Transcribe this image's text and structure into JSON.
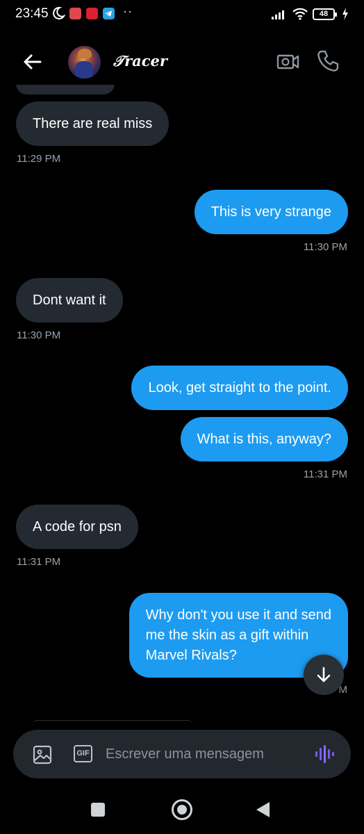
{
  "status_bar": {
    "time": "23:45",
    "battery": "48",
    "icons": [
      "moon-icon",
      "app-notification-icon",
      "app-notification-icon",
      "telegram-icon",
      "more-dots-icon",
      "signal-icon",
      "wifi-icon",
      "battery-icon",
      "charging-icon"
    ]
  },
  "header": {
    "contact_name": "𝒯racer",
    "back_icon": "arrow-left-icon",
    "video_icon": "video-camera-icon",
    "call_icon": "phone-icon"
  },
  "messages": [
    {
      "dir": "in",
      "text": "There are real miss",
      "time": "11:29 PM"
    },
    {
      "dir": "out",
      "text": "This is very strange",
      "time": "11:30 PM"
    },
    {
      "dir": "in",
      "text": "Dont want it",
      "time": "11:30 PM"
    },
    {
      "dir": "out",
      "text": "Look, get straight to the point.",
      "time": ""
    },
    {
      "dir": "out",
      "text": "What is this, anyway?",
      "time": "11:31 PM"
    },
    {
      "dir": "in",
      "text": "A code for psn",
      "time": "11:31 PM"
    },
    {
      "dir": "out",
      "text": "Why don't you use it and send\nme the skin as a gift within\nMarvel Rivals?",
      "time": ""
    }
  ],
  "partial_timestamp": "1",
  "partial_timestamp_suffix": "M",
  "composer": {
    "placeholder": "Escrever uma mensagem",
    "gif_label": "GIF",
    "image_icon": "image-icon",
    "voice_icon": "voice-wave-icon"
  },
  "colors": {
    "outgoing_bubble": "#1d9bf0",
    "incoming_bubble": "#232a31",
    "background": "#000000",
    "voice_accent": "#8b5cf6"
  }
}
